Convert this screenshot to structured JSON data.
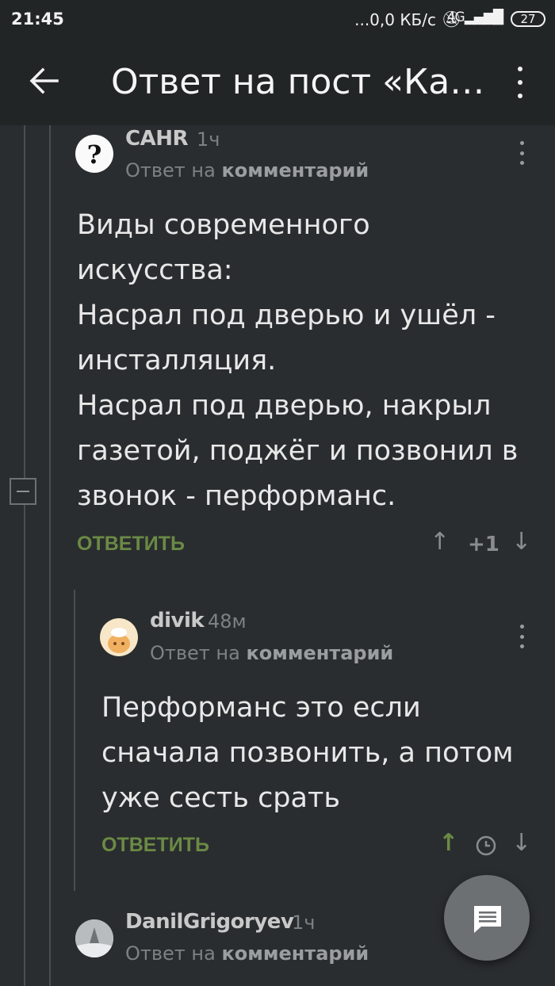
{
  "status_bar": {
    "time": "21:45",
    "network": "...0,0 КБ/с",
    "signal": "4G",
    "battery": "27"
  },
  "toolbar": {
    "title": "Ответ на пост «Ка…",
    "back_icon": "arrow-left-icon",
    "more_icon": "more-vertical-icon"
  },
  "comments": [
    {
      "author": "CAHR",
      "ago": "1ч",
      "reply_prefix": "Ответ на",
      "reply_target": "комментарий",
      "body": "Виды современного\nискусства:\nНасрал под дверью и ушёл -\nинсталляция.\nНасрал под дверью, накрыл\nгазетой, поджёг и позвонил в\nзвонок - перформанс.",
      "reply_label": "ОТВЕТИТЬ",
      "rating": "+1"
    },
    {
      "author": "divik",
      "ago": "48м",
      "reply_prefix": "Ответ на",
      "reply_target": "комментарий",
      "body": "Перформанс это если\nсначала позвонить, а потом\nуже сесть срать",
      "reply_label": "ОТВЕТИТЬ",
      "upvoted_color": "#6b8a45"
    },
    {
      "author": "DanilGrigoryev",
      "ago": "1ч",
      "reply_prefix": "Ответ на",
      "reply_target": "комментарий"
    }
  ],
  "colors": {
    "background": "#2a2d2f",
    "toolbar": "#222526",
    "accent_green": "#6b8a45"
  }
}
